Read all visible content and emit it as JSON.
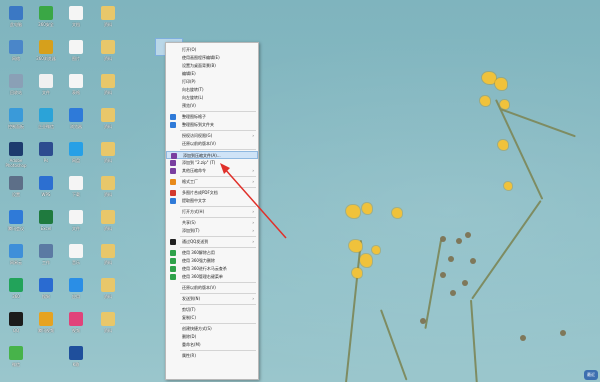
{
  "desktop": {
    "selected_file_label": "新建",
    "corner_badge": "最近",
    "icons_col1": [
      {
        "label": "此电脑",
        "color": "#3b78c4"
      },
      {
        "label": "网络",
        "color": "#4a86c9"
      },
      {
        "label": "回收站",
        "color": "#8aa0b6"
      },
      {
        "label": "控制面板",
        "color": "#3a9ad9"
      },
      {
        "label": "Adobe Photoshop",
        "color": "#1d3b6e"
      },
      {
        "label": "设置",
        "color": "#5d6f88"
      },
      {
        "label": "腾讯会议",
        "color": "#2f7ad8"
      },
      {
        "label": "网易云",
        "color": "#3e8fd9"
      },
      {
        "label": "360",
        "color": "#22a35a"
      },
      {
        "label": "QQ",
        "color": "#1c1c1c"
      },
      {
        "label": "微信",
        "color": "#47b34a"
      }
    ],
    "icons_col2": [
      {
        "label": "360安全",
        "color": "#3aa745"
      },
      {
        "label": "360浏览器",
        "color": "#d6a01c"
      },
      {
        "label": "文件",
        "color": "#f1f1f1"
      },
      {
        "label": "企业微信",
        "color": "#2ba3d8"
      },
      {
        "label": "Ps",
        "color": "#2d4c8f"
      },
      {
        "label": "WPS",
        "color": "#2c6fd1"
      },
      {
        "label": "Excel",
        "color": "#1f7a3e"
      },
      {
        "label": "工作",
        "color": "#5b7aa3"
      },
      {
        "label": "搜狗",
        "color": "#2a6bd1"
      },
      {
        "label": "腾讯视频",
        "color": "#e6a321"
      }
    ],
    "icons_col3": [
      {
        "label": "文档",
        "color": "#f5f5f5"
      },
      {
        "label": "图片",
        "color": "#f5f5f5"
      },
      {
        "label": "表格",
        "color": "#f5f5f5"
      },
      {
        "label": "浏览器",
        "color": "#2e7ad9"
      },
      {
        "label": "网盘",
        "color": "#27a0e6"
      },
      {
        "label": "下载",
        "color": "#f5f5f5"
      },
      {
        "label": "文件",
        "color": "#f5f5f5"
      },
      {
        "label": "音乐",
        "color": "#f5f5f5"
      },
      {
        "label": "应用",
        "color": "#2a8ee6"
      },
      {
        "label": "视频",
        "color": "#e0437a"
      },
      {
        "label": "K歌",
        "color": "#1f4f9c"
      }
    ],
    "icons_col4": [
      {
        "label": "资料",
        "color": "#e8c76a"
      },
      {
        "label": "资料",
        "color": "#e8c76a"
      },
      {
        "label": "资料",
        "color": "#e8c76a"
      },
      {
        "label": "资料",
        "color": "#e8c76a"
      },
      {
        "label": "资料",
        "color": "#e8c76a"
      },
      {
        "label": "资料",
        "color": "#e8c76a"
      },
      {
        "label": "资料",
        "color": "#e8c76a"
      },
      {
        "label": "资料",
        "color": "#e8c76a"
      },
      {
        "label": "资料",
        "color": "#e8c76a"
      },
      {
        "label": "资料",
        "color": "#e8c76a"
      }
    ]
  },
  "context_menu": {
    "items": [
      {
        "label": "打开(O)",
        "icon": "none",
        "type": "item"
      },
      {
        "label": "使用画图程序编辑(E)",
        "icon": "none",
        "type": "item"
      },
      {
        "label": "设置为桌面背景(B)",
        "icon": "none",
        "type": "item"
      },
      {
        "label": "编辑(E)",
        "icon": "none",
        "type": "item"
      },
      {
        "label": "打印(P)",
        "icon": "none",
        "type": "item"
      },
      {
        "label": "向右旋转(T)",
        "icon": "none",
        "type": "item"
      },
      {
        "label": "向左旋转(L)",
        "icon": "none",
        "type": "item"
      },
      {
        "label": "预览(V)",
        "icon": "none",
        "type": "item"
      },
      {
        "type": "sep"
      },
      {
        "label": "整理图标格子",
        "icon": "blue",
        "type": "item"
      },
      {
        "label": "整理图标到文件夹",
        "icon": "blue",
        "type": "item"
      },
      {
        "type": "sep"
      },
      {
        "label": "授权访问权限(G)",
        "icon": "none",
        "type": "item",
        "arrow": true
      },
      {
        "label": "还原以前的版本(V)",
        "icon": "none",
        "type": "item"
      },
      {
        "type": "sep"
      },
      {
        "label": "添加到压缩文件(A)...",
        "icon": "rar",
        "type": "item",
        "highlight": true
      },
      {
        "label": "添加到 \"2.zip\" (T)",
        "icon": "rar",
        "type": "item"
      },
      {
        "label": "其他压缩命令",
        "icon": "rar",
        "type": "item",
        "arrow": true
      },
      {
        "type": "sep"
      },
      {
        "label": "格式工厂",
        "icon": "orange",
        "type": "item",
        "arrow": true
      },
      {
        "type": "sep"
      },
      {
        "label": "多图片合成PDF文档",
        "icon": "red",
        "type": "item"
      },
      {
        "label": "提取图中文字",
        "icon": "blue",
        "type": "item"
      },
      {
        "type": "sep"
      },
      {
        "label": "打开方式(H)",
        "icon": "none",
        "type": "item",
        "arrow": true
      },
      {
        "type": "sep"
      },
      {
        "label": "共享(S)",
        "icon": "none",
        "type": "item",
        "arrow": true
      },
      {
        "label": "添加到(T)",
        "icon": "none",
        "type": "item",
        "arrow": true
      },
      {
        "type": "sep"
      },
      {
        "label": "通过QQ发送到",
        "icon": "penguin",
        "type": "item",
        "arrow": true
      },
      {
        "type": "sep"
      },
      {
        "label": "使用 360解除占用",
        "icon": "green",
        "type": "item"
      },
      {
        "label": "使用 360强力删除",
        "icon": "green",
        "type": "item"
      },
      {
        "label": "使用 360进行木马云查杀",
        "icon": "green",
        "type": "item"
      },
      {
        "label": "使用 360管理右键菜单",
        "icon": "green",
        "type": "item"
      },
      {
        "type": "sep"
      },
      {
        "label": "还原以前的版本(V)",
        "icon": "none",
        "type": "item"
      },
      {
        "type": "sep"
      },
      {
        "label": "发送到(N)",
        "icon": "none",
        "type": "item",
        "arrow": true
      },
      {
        "type": "sep"
      },
      {
        "label": "剪切(T)",
        "icon": "none",
        "type": "item"
      },
      {
        "label": "复制(C)",
        "icon": "none",
        "type": "item"
      },
      {
        "type": "sep"
      },
      {
        "label": "创建快捷方式(S)",
        "icon": "none",
        "type": "item"
      },
      {
        "label": "删除(D)",
        "icon": "none",
        "type": "item"
      },
      {
        "label": "重命名(M)",
        "icon": "none",
        "type": "item"
      },
      {
        "type": "sep"
      },
      {
        "label": "属性(R)",
        "icon": "none",
        "type": "item"
      }
    ]
  },
  "colors": {
    "arrow": "#e0302a",
    "menu_highlight": "#cfe3f7",
    "flower": "#f0c23b"
  }
}
